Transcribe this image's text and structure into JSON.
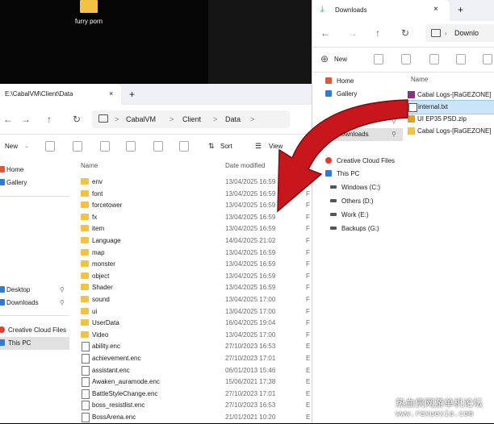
{
  "desktop": {
    "folder_label": "furry porn"
  },
  "explorer": {
    "tab_title": "E:\\CabalVM\\Client\\Data",
    "tab_close": "×",
    "new_tab": "+",
    "nav": {
      "back": "←",
      "forward": "→",
      "up": "↑",
      "refresh": "↻"
    },
    "breadcrumbs": [
      "CabalVM",
      "Client",
      "Data"
    ],
    "breadcrumb_sep": ">",
    "toolbar": {
      "new": "New",
      "sort": "Sort",
      "view": "View"
    },
    "sidebar": [
      {
        "label": "Home",
        "color": "#e0573b"
      },
      {
        "label": "Gallery",
        "color": "#2f7bd6"
      },
      {
        "label": "Desktop",
        "color": "#2f7bd6"
      },
      {
        "label": "Downloads",
        "color": "#2f7bd6"
      },
      {
        "label": "Creative Cloud Files",
        "color": "#e8382f"
      },
      {
        "label": "This PC",
        "color": "#2f7bd6"
      }
    ],
    "columns": {
      "name": "Name",
      "date": "Date modified"
    },
    "files": [
      {
        "name": "env",
        "date": "13/04/2025 16:59",
        "type": "F",
        "kind": "folder"
      },
      {
        "name": "font",
        "date": "13/04/2025 16:59",
        "type": "F",
        "kind": "folder"
      },
      {
        "name": "forcetower",
        "date": "13/04/2025 16:59",
        "type": "F",
        "kind": "folder"
      },
      {
        "name": "fx",
        "date": "13/04/2025 16:59",
        "type": "F",
        "kind": "folder"
      },
      {
        "name": "item",
        "date": "13/04/2025 16:59",
        "type": "F",
        "kind": "folder"
      },
      {
        "name": "Language",
        "date": "14/04/2025 21:02",
        "type": "F",
        "kind": "folder"
      },
      {
        "name": "map",
        "date": "13/04/2025 16:59",
        "type": "F",
        "kind": "folder"
      },
      {
        "name": "monster",
        "date": "13/04/2025 16:59",
        "type": "F",
        "kind": "folder"
      },
      {
        "name": "object",
        "date": "13/04/2025 16:59",
        "type": "F",
        "kind": "folder"
      },
      {
        "name": "Shader",
        "date": "13/04/2025 16:59",
        "type": "F",
        "kind": "folder"
      },
      {
        "name": "sound",
        "date": "13/04/2025 17:00",
        "type": "F",
        "kind": "folder"
      },
      {
        "name": "ui",
        "date": "13/04/2025 17:00",
        "type": "F",
        "kind": "folder"
      },
      {
        "name": "UserData",
        "date": "16/04/2025 19:04",
        "type": "F",
        "kind": "folder"
      },
      {
        "name": "Video",
        "date": "13/04/2025 17:00",
        "type": "F",
        "kind": "folder"
      },
      {
        "name": "ability.enc",
        "date": "27/10/2023 16:53",
        "type": "E",
        "kind": "file"
      },
      {
        "name": "achievement.enc",
        "date": "27/10/2023 17:01",
        "type": "E",
        "kind": "file"
      },
      {
        "name": "assistant.enc",
        "date": "06/01/2013 15:46",
        "type": "E",
        "kind": "file"
      },
      {
        "name": "Awaken_auramode.enc",
        "date": "15/06/2021 17:38",
        "type": "E",
        "kind": "file"
      },
      {
        "name": "BattleStyleChange.enc",
        "date": "27/10/2023 17:01",
        "type": "E",
        "kind": "file"
      },
      {
        "name": "boss_resistlist.enc",
        "date": "27/10/2023 16:53",
        "type": "E",
        "kind": "file"
      },
      {
        "name": "BossArena.enc",
        "date": "21/01/2021 10:20",
        "type": "E",
        "kind": "file"
      }
    ]
  },
  "downloads": {
    "tab_title": "Downloads",
    "tab_close": "×",
    "new_tab": "+",
    "nav": {
      "back": "←",
      "forward": "→",
      "up": "↑",
      "refresh": "↻"
    },
    "path": "Downlo",
    "toolbar": {
      "new": "New"
    },
    "sidebar": [
      {
        "label": "Home",
        "color": "#e0573b"
      },
      {
        "label": "Gallery",
        "color": "#2f7bd6"
      },
      {
        "label": "ktop",
        "color": "#2f7bd6"
      },
      {
        "label": "Downloads",
        "color": "#2f7bd6"
      },
      {
        "label": "Creative Cloud Files",
        "color": "#e8382f"
      },
      {
        "label": "This PC",
        "color": "#2f7bd6"
      },
      {
        "label": "Windows (C:)",
        "color": "#555555"
      },
      {
        "label": "Others (D:)",
        "color": "#555555"
      },
      {
        "label": "Work (E:)",
        "color": "#555555"
      },
      {
        "label": "Backups (G:)",
        "color": "#555555"
      }
    ],
    "column_name": "Name",
    "files": [
      {
        "name": "Cabal Logs-[RaGEZONE]",
        "kind": "rar"
      },
      {
        "name": "internal.txt",
        "kind": "txt"
      },
      {
        "name": "UI EP35 PSD.zip",
        "kind": "zip"
      },
      {
        "name": "Cabal Logs-[RaGEZONE]",
        "kind": "folder"
      }
    ]
  },
  "watermark": {
    "cn": "热血侠网游单机论坛",
    "en": "www.rexuexia.com"
  },
  "colors": {
    "arrow": "#c8161d",
    "folder": "#f4c243",
    "selection": "#cce4f7"
  }
}
